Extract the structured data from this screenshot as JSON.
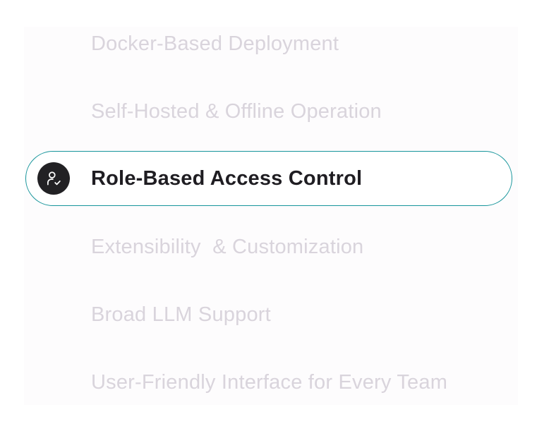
{
  "features": {
    "items": [
      {
        "label": "Docker-Based Deployment"
      },
      {
        "label": "Self-Hosted & Offline Operation"
      },
      {
        "label": "Role-Based Access Control",
        "icon": "user-check-icon",
        "active": true
      },
      {
        "label": "Extensibility  & Customization"
      },
      {
        "label": "Broad LLM Support"
      },
      {
        "label": "User-Friendly Interface for Every Team"
      }
    ]
  },
  "colors": {
    "accent_border": "#17959b",
    "active_text": "#1f1d22",
    "inactive_text": "#d9d4dc",
    "icon_background": "#222124"
  }
}
